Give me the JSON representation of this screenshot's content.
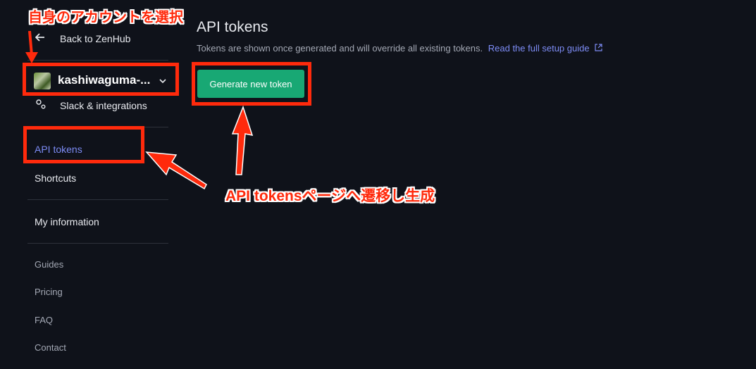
{
  "sidebar": {
    "back_label": "Back to ZenHub",
    "workspace_name": "kashiwaguma-...",
    "integrations_label": "Slack & integrations",
    "items": [
      {
        "label": "API tokens"
      },
      {
        "label": "Shortcuts"
      },
      {
        "label": "My information"
      }
    ],
    "links": [
      {
        "label": "Guides"
      },
      {
        "label": "Pricing"
      },
      {
        "label": "FAQ"
      },
      {
        "label": "Contact"
      }
    ]
  },
  "main": {
    "title": "API tokens",
    "description": "Tokens are shown once generated and will override all existing tokens.",
    "guide_link": "Read the full setup guide",
    "generate_button": "Generate new token"
  },
  "annotations": {
    "select_account": "自身のアカウントを選択",
    "navigate_generate": "API tokensページへ遷移し生成"
  },
  "colors": {
    "background": "#0f121a",
    "accent_link": "#7d8cf5",
    "button_green": "#18a874",
    "annotation_red": "#ff2a0c"
  }
}
